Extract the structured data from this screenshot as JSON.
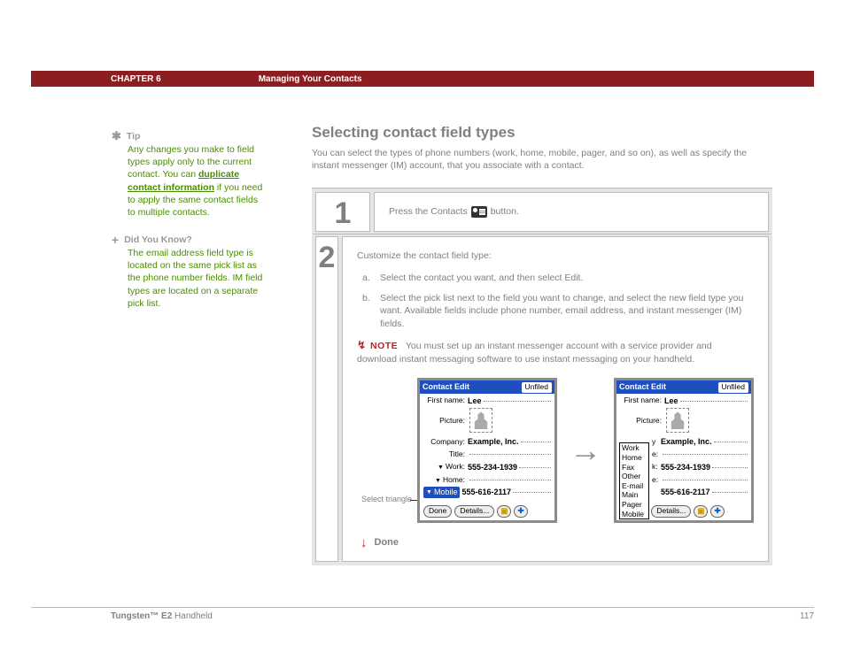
{
  "header": {
    "chapter": "CHAPTER 6",
    "title": "Managing Your Contacts"
  },
  "sidebar": {
    "tip": {
      "label": "Tip",
      "body_pre": "Any changes you make to field types apply only to the current contact. You can ",
      "link": "duplicate contact information",
      "body_post": " if you need to apply the same contact fields to multiple contacts."
    },
    "dyk": {
      "label": "Did You Know?",
      "body": "The email address field type is located on the same pick list as the phone number fields. IM field types are located on a separate pick list."
    }
  },
  "main": {
    "heading": "Selecting contact field types",
    "intro": "You can select the types of phone numbers (work, home, mobile, pager, and so on), as well as specify the instant messenger (IM) account, that you associate with a contact.",
    "step1": {
      "num": "1",
      "pre": "Press the Contacts",
      "post": "button."
    },
    "step2": {
      "num": "2",
      "lead": "Customize the contact field type:",
      "a": "Select the contact you want, and then select Edit.",
      "b": "Select the pick list next to the field you want to change, and select the new field type you want. Available fields include phone number, email address, and instant messenger (IM) fields.",
      "note_label": "NOTE",
      "note": "You must set up an instant messenger account with a service provider and download instant messaging software to use instant messaging on your handheld."
    },
    "shot_label": "Select triangle",
    "done": "Done"
  },
  "palm": {
    "title": "Contact Edit",
    "category": "Unfiled",
    "first_label": "First name:",
    "first_val": "Lee",
    "pic_label": "Picture:",
    "company_label": "Company:",
    "company_val": "Example, Inc.",
    "title_label": "Title:",
    "work_label": "Work:",
    "work_val": "555-234-1939",
    "home_label": "Home:",
    "mobile_label": "Mobile",
    "mobile_val": "555-616-2117",
    "btn_done": "Done",
    "btn_details": "Details...",
    "picklist": [
      "Work",
      "Home",
      "Fax",
      "Other",
      "E-mail",
      "Main",
      "Pager",
      "Mobile"
    ],
    "p2_row1_label": "y",
    "p2_row2_label": "e:",
    "p2_row3_label": "k:",
    "p2_row4_label": "e:"
  },
  "footer": {
    "product_bold": "Tungsten™ E2",
    "product_rest": " Handheld",
    "page": "117"
  }
}
